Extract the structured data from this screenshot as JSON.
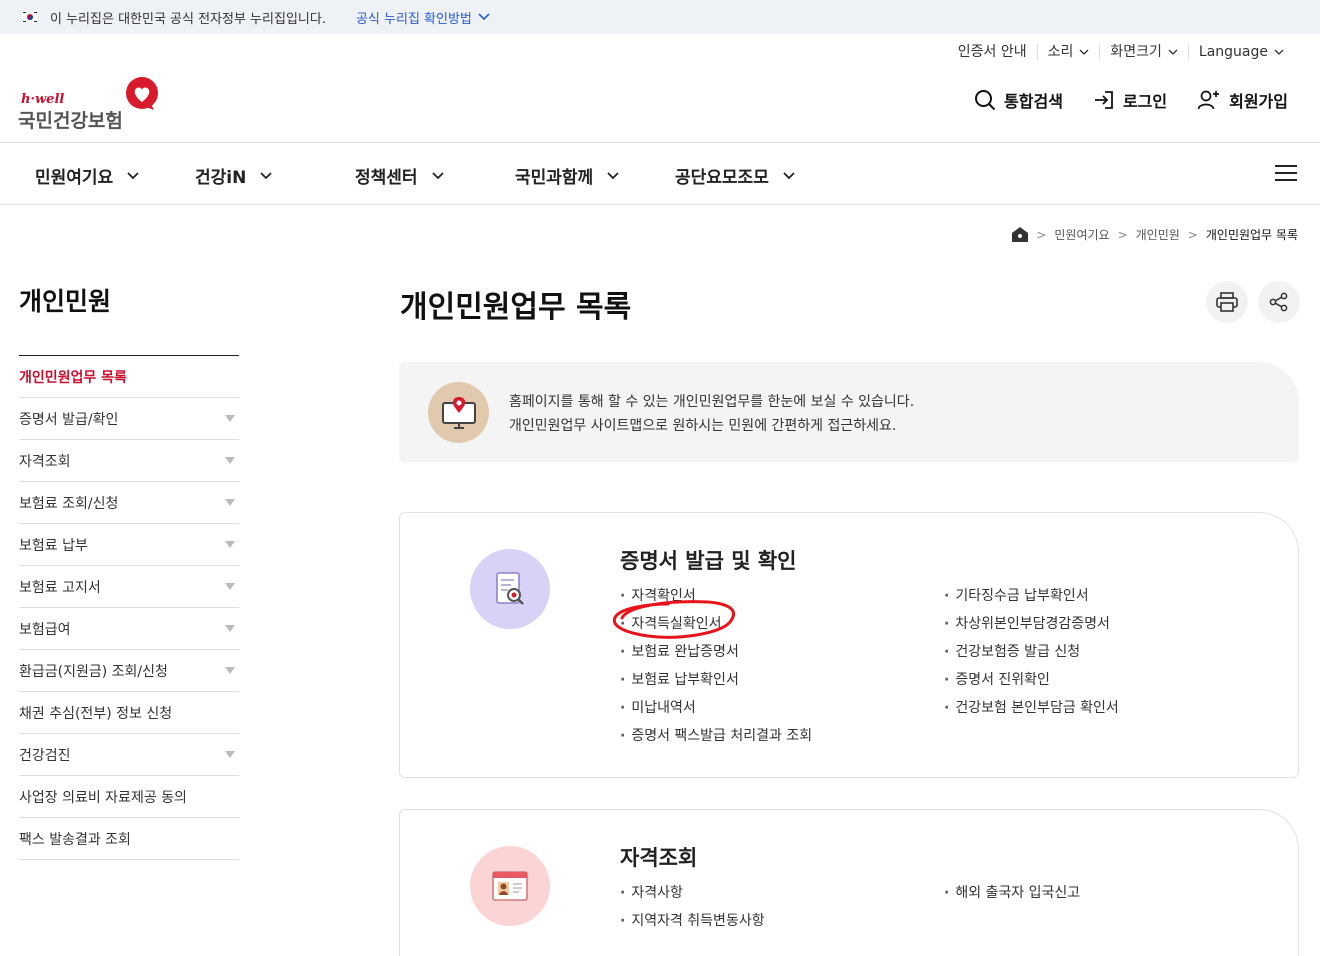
{
  "gov_banner": {
    "text": "이 누리집은 대한민국 공식 전자정부 누리집입니다.",
    "link": "공식 누리집 확인방법"
  },
  "util": {
    "items": [
      "인증서 안내",
      "소리",
      "화면크기",
      "Language"
    ]
  },
  "logo": {
    "brand": "h·well",
    "name": "국민건강보험"
  },
  "header_actions": {
    "search": "통합검색",
    "login": "로그인",
    "join": "회원가입"
  },
  "gnb": {
    "items": [
      "민원여기요",
      "건강iN",
      "정책센터",
      "국민과함께",
      "공단요모조모"
    ]
  },
  "breadcrumb": {
    "items": [
      "민원여기요",
      "개인민원",
      "개인민원업무 목록"
    ]
  },
  "sidebar": {
    "title": "개인민원",
    "items": [
      {
        "label": "개인민원업무 목록"
      },
      {
        "label": "증명서 발급/확인"
      },
      {
        "label": "자격조회"
      },
      {
        "label": "보험료 조회/신청"
      },
      {
        "label": "보험료 납부"
      },
      {
        "label": "보험료 고지서"
      },
      {
        "label": "보험급여"
      },
      {
        "label": "환급금(지원금) 조회/신청"
      },
      {
        "label": "채권 추심(전부) 정보 신청"
      },
      {
        "label": "건강검진"
      },
      {
        "label": "사업장 의료비 자료제공 동의"
      },
      {
        "label": "팩스 발송결과 조회"
      }
    ]
  },
  "page": {
    "title": "개인민원업무 목록",
    "info_line1": "홈페이지를 통해 할 수 있는 개인민원업무를 한눈에 보실 수 있습니다.",
    "info_line2": "개인민원업무 사이트맵으로 원하시는 민원에 간편하게 접근하세요."
  },
  "cards": [
    {
      "title": "증명서 발급 및 확인",
      "left": [
        "자격확인서",
        "자격득실확인서",
        "보험료 완납증명서",
        "보험료 납부확인서",
        "미납내역서",
        "증명서 팩스발급 처리결과 조회"
      ],
      "right": [
        "기타징수금 납부확인서",
        "차상위본인부담경감증명서",
        "건강보험증 발급 신청",
        "증명서 진위확인",
        "건강보험 본인부담금 확인서"
      ]
    },
    {
      "title": "자격조회",
      "left": [
        "자격사항",
        "지역자격 취득변동사항"
      ],
      "right": [
        "해외 출국자 입국신고"
      ]
    }
  ],
  "colors": {
    "accent": "#c8102e",
    "link": "#2a5bd7",
    "annotation": "#e8141c",
    "card1_circle": "#d9d2f6",
    "card2_circle": "#fbd4d6"
  }
}
